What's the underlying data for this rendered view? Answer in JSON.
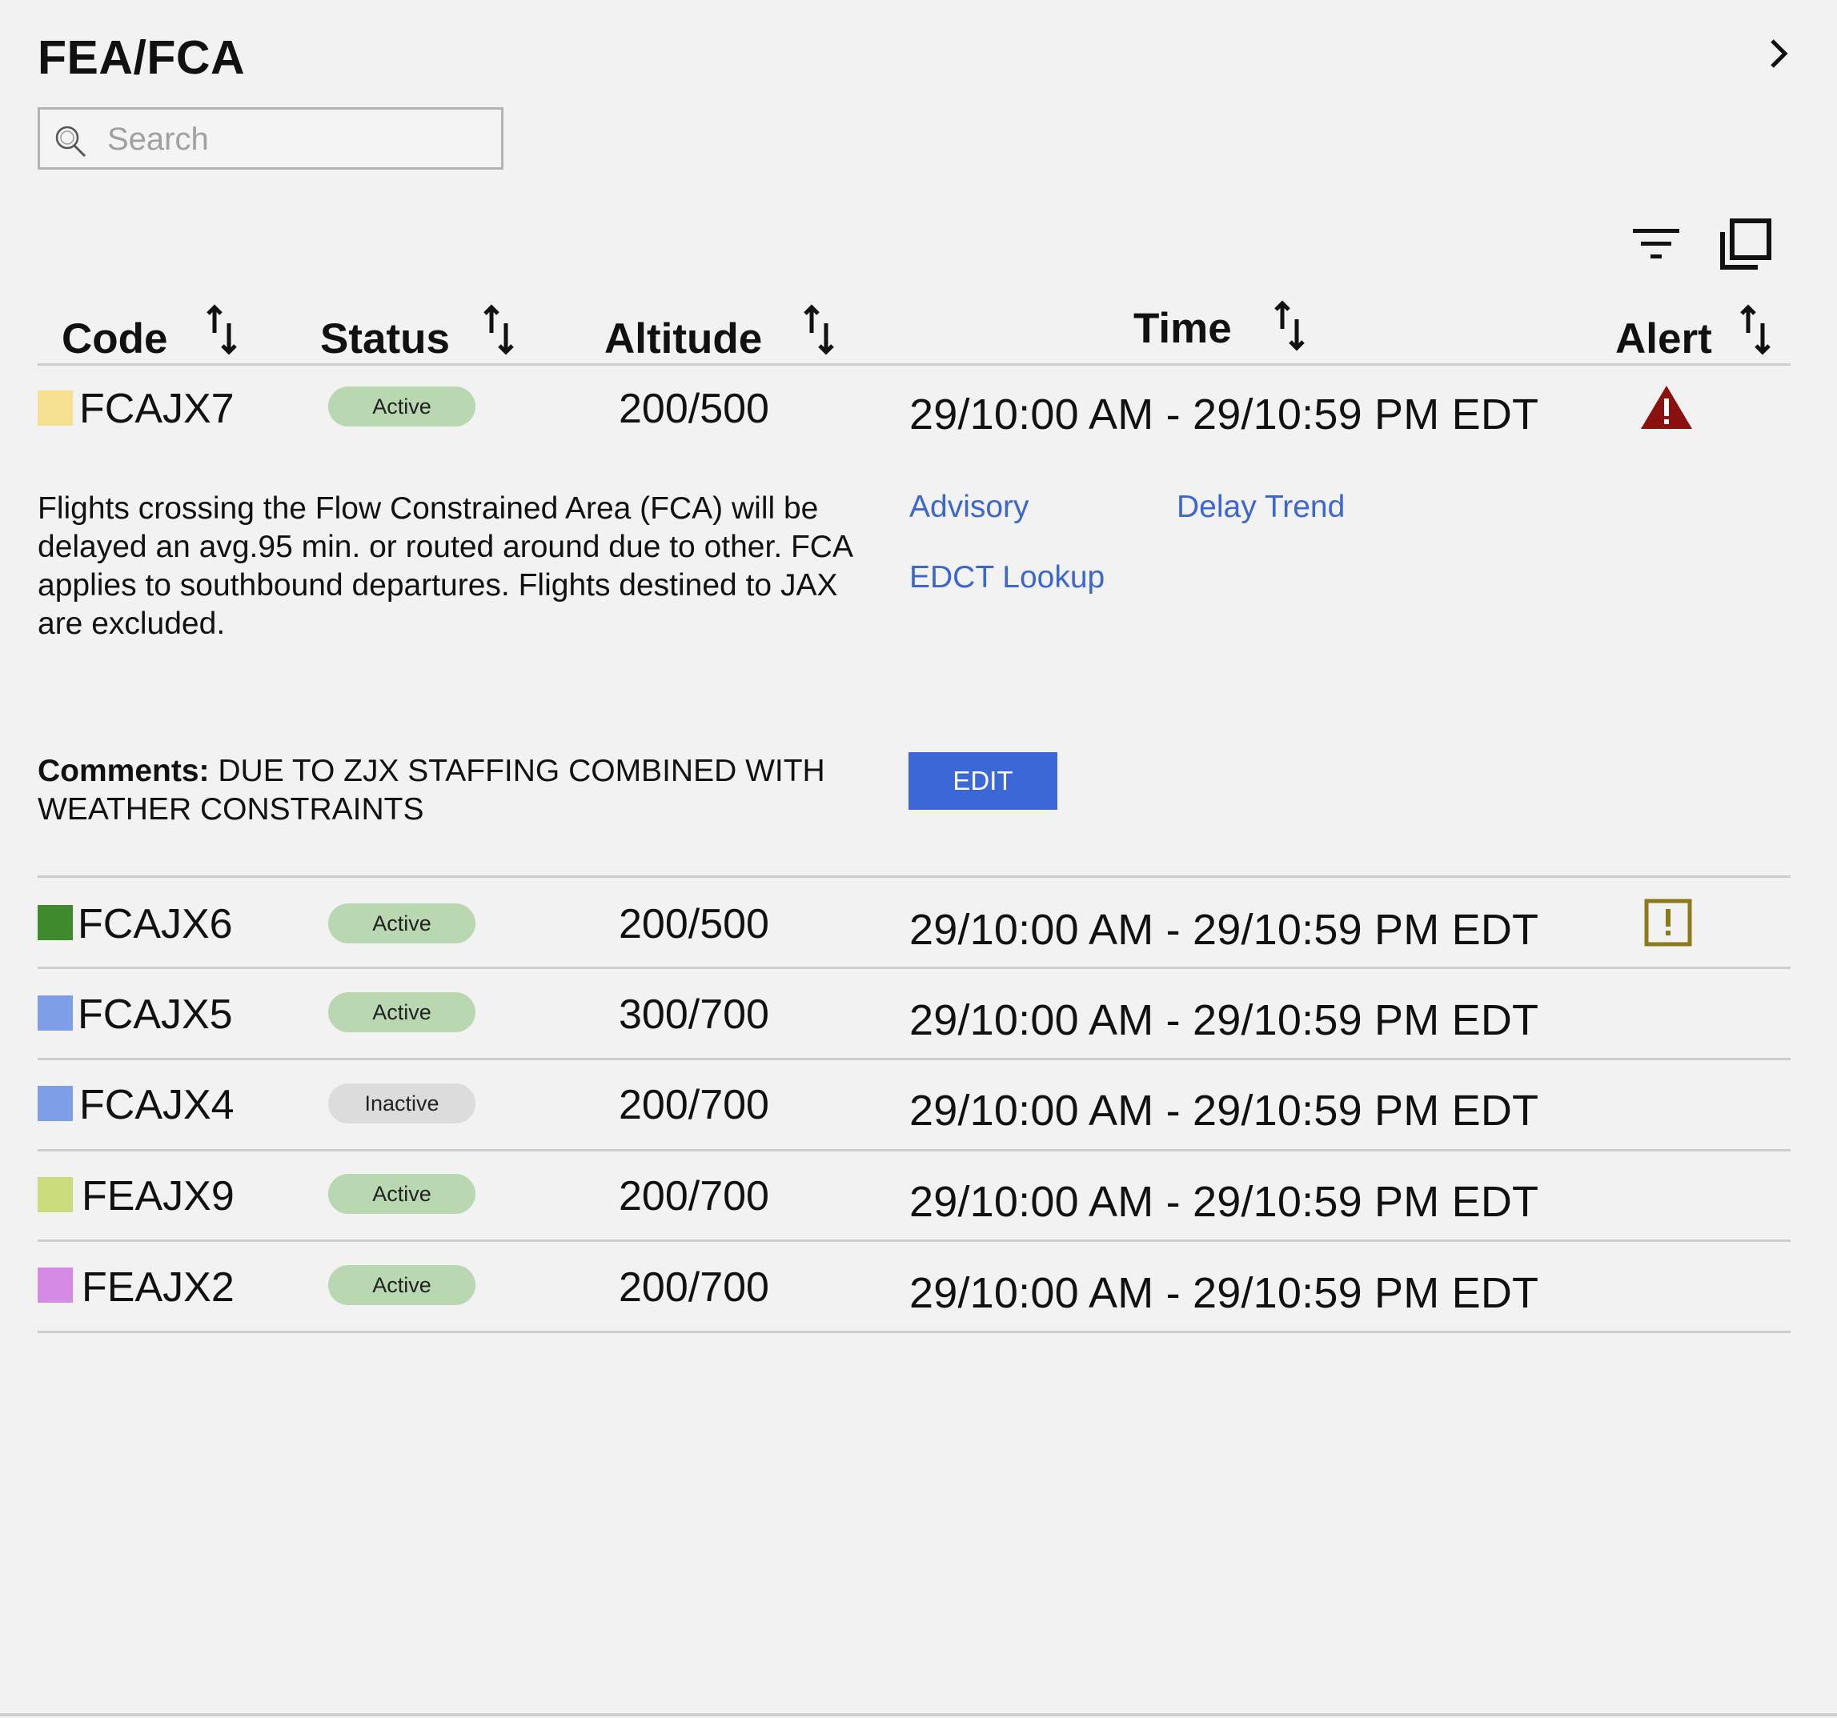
{
  "header": {
    "title": "FEA/FCA"
  },
  "search": {
    "placeholder": "Search"
  },
  "toolbar": {
    "filter_icon": "filter-icon",
    "copy_icon": "copy-icon",
    "expand_icon": "chevron-right-icon"
  },
  "table": {
    "columns": [
      "Code",
      "Status",
      "Altitude",
      "Time",
      "Alert"
    ],
    "rows": [
      {
        "color": "#f4e08e",
        "code": "FCAJX7",
        "status": "Active",
        "altitude": "200/500",
        "time": "29/10:00 AM - 29/10:59 PM EDT",
        "alert": "warning-triangle-icon"
      },
      {
        "color": "#3f8a2d",
        "code": "FCAJX6",
        "status": "Active",
        "altitude": "200/500",
        "time": "29/10:00 AM - 29/10:59 PM EDT",
        "alert": "exclamation-box-icon"
      },
      {
        "color": "#7e9ee8",
        "code": "FCAJX5",
        "status": "Active",
        "altitude": "300/700",
        "time": "29/10:00 AM - 29/10:59 PM EDT",
        "alert": ""
      },
      {
        "color": "#7e9ee8",
        "code": "FCAJX4",
        "status": "Inactive",
        "altitude": "200/700",
        "time": "29/10:00 AM - 29/10:59 PM EDT",
        "alert": ""
      },
      {
        "color": "#c9dd7c",
        "code": "FEAJX9",
        "status": "Active",
        "altitude": "200/700",
        "time": "29/10:00 AM - 29/10:59 PM EDT",
        "alert": ""
      },
      {
        "color": "#d58be6",
        "code": "FEAJX2",
        "status": "Active",
        "altitude": "200/700",
        "time": "29/10:00 AM - 29/10:59 PM EDT",
        "alert": ""
      }
    ]
  },
  "details": {
    "description": "Flights crossing the Flow Constrained Area (FCA) will be delayed an avg.95 min. or routed around due to other. FCA applies to southbound departures. Flights destined to JAX are excluded.",
    "links": {
      "advisory": "Advisory",
      "delay_trend": "Delay Trend",
      "edct_lookup": "EDCT Lookup"
    },
    "comments_label": "Comments:",
    "comments_text": " DUE TO ZJX STAFFING COMBINED WITH WEATHER CONSTRAINTS",
    "edit_label": "EDIT"
  },
  "colors": {
    "accent": "#3c67d6",
    "link": "#3c67cf",
    "alert_critical": "#8b1010",
    "alert_warning": "#8a7a1a",
    "active_pill": "#b9d7b1",
    "inactive_pill": "#dcdcdc"
  }
}
